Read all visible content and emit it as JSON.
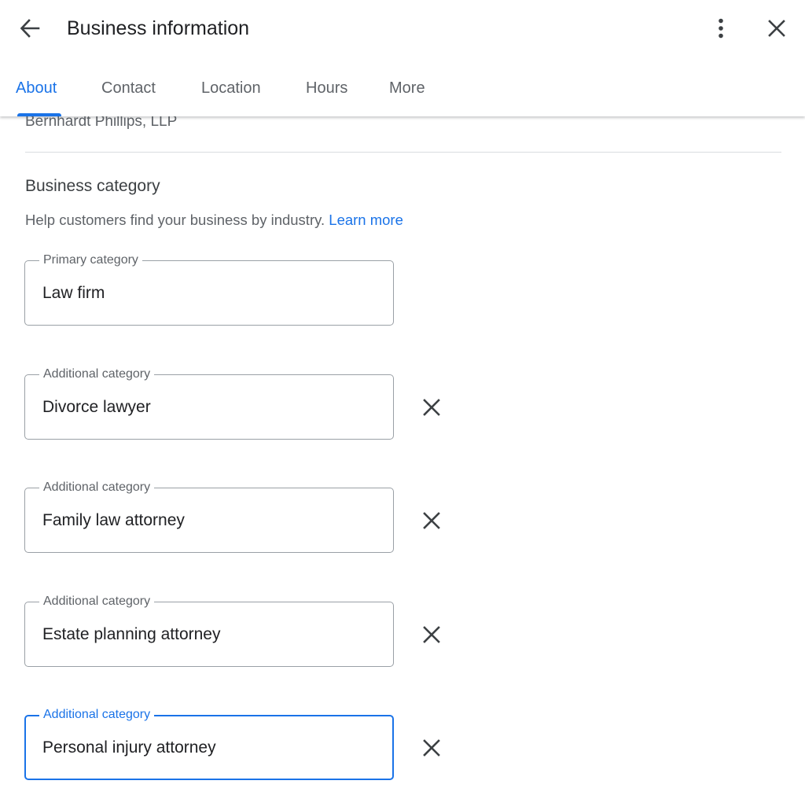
{
  "header": {
    "title": "Business information",
    "back_icon": "arrow-left-icon",
    "more_icon": "more-vert-icon",
    "close_icon": "close-icon"
  },
  "tabs": [
    {
      "label": "About",
      "active": true
    },
    {
      "label": "Contact",
      "active": false
    },
    {
      "label": "Location",
      "active": false
    },
    {
      "label": "Hours",
      "active": false
    },
    {
      "label": "More",
      "active": false
    }
  ],
  "business_name": "Bernhardt Phillips, LLP",
  "category_section": {
    "title": "Business category",
    "description": "Help customers find your business by industry.",
    "learn_more": "Learn more",
    "primary": {
      "label": "Primary category",
      "value": "Law firm"
    },
    "additional": [
      {
        "label": "Additional category",
        "value": "Divorce lawyer"
      },
      {
        "label": "Additional category",
        "value": "Family law attorney"
      },
      {
        "label": "Additional category",
        "value": "Estate planning attorney"
      },
      {
        "label": "Additional category",
        "value": "Personal injury attorney",
        "focused": true
      }
    ]
  },
  "colors": {
    "accent": "#1a73e8",
    "text_primary": "#202124",
    "text_secondary": "#5f6368",
    "outline": "#9aa0a6",
    "divider": "#dadce0"
  }
}
